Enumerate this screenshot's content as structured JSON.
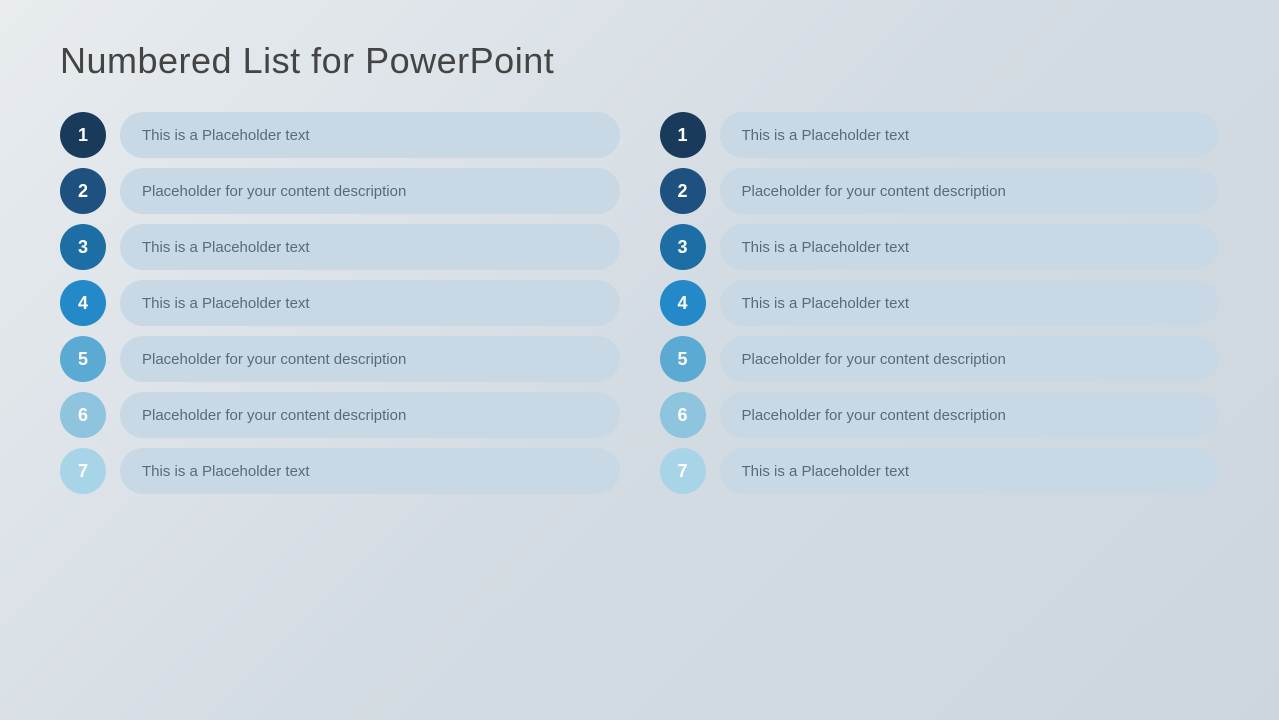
{
  "slide": {
    "title": "Numbered List for PowerPoint",
    "left_column": [
      {
        "number": "1",
        "text": "This is a Placeholder text",
        "color_class": "c1"
      },
      {
        "number": "2",
        "text": "Placeholder for your content description",
        "color_class": "c2"
      },
      {
        "number": "3",
        "text": "This is a Placeholder text",
        "color_class": "c3"
      },
      {
        "number": "4",
        "text": "This is a Placeholder text",
        "color_class": "c4"
      },
      {
        "number": "5",
        "text": "Placeholder for your content description",
        "color_class": "c5"
      },
      {
        "number": "6",
        "text": "Placeholder for your content description",
        "color_class": "c6"
      },
      {
        "number": "7",
        "text": "This is a Placeholder text",
        "color_class": "c7"
      }
    ],
    "right_column": [
      {
        "number": "1",
        "text": "This is a Placeholder text",
        "color_class": "c1"
      },
      {
        "number": "2",
        "text": "Placeholder for your content description",
        "color_class": "c2"
      },
      {
        "number": "3",
        "text": "This is a Placeholder text",
        "color_class": "c3"
      },
      {
        "number": "4",
        "text": "This is a Placeholder text",
        "color_class": "c4"
      },
      {
        "number": "5",
        "text": "Placeholder for your content description",
        "color_class": "c5"
      },
      {
        "number": "6",
        "text": "Placeholder for your content description",
        "color_class": "c6"
      },
      {
        "number": "7",
        "text": "This is a Placeholder text",
        "color_class": "c7"
      }
    ]
  }
}
